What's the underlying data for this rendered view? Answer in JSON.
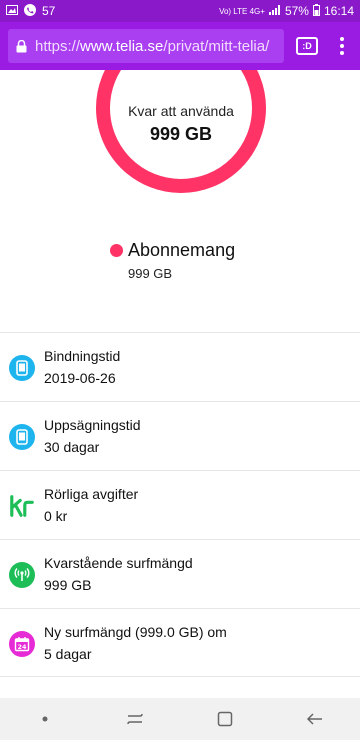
{
  "status_bar": {
    "notification_count": "57",
    "network": "Vo) LTE 4G+",
    "battery": "57%",
    "time": "16:14"
  },
  "browser": {
    "url_prefix": "https://",
    "url_host": "www.telia.se",
    "url_path": "/privat/mitt-telia/",
    "tab_label": ":D"
  },
  "usage": {
    "label": "Kvar att använda",
    "value": "999 GB",
    "accent_color": "#ff3366"
  },
  "legend": {
    "title": "Abonnemang",
    "value": "999 GB"
  },
  "items": [
    {
      "icon": "phone-icon",
      "title": "Bindningstid",
      "value": "2019-06-26"
    },
    {
      "icon": "phone-icon",
      "title": "Uppsägningstid",
      "value": "30 dagar"
    },
    {
      "icon": "kr-icon",
      "title": "Rörliga avgifter",
      "value": "0 kr"
    },
    {
      "icon": "signal-icon",
      "title": "Kvarstående surfmängd",
      "value": "999 GB"
    },
    {
      "icon": "calendar-icon",
      "title": "Ny surfmängd (999.0 GB) om",
      "value": "5 dagar"
    }
  ],
  "colors": {
    "brand_purple": "#9a1ce3",
    "phone_icon": "#1eb4ee",
    "kr_icon": "#1dbd57",
    "signal_icon": "#1dbd57",
    "calendar_icon": "#e62ad6"
  }
}
